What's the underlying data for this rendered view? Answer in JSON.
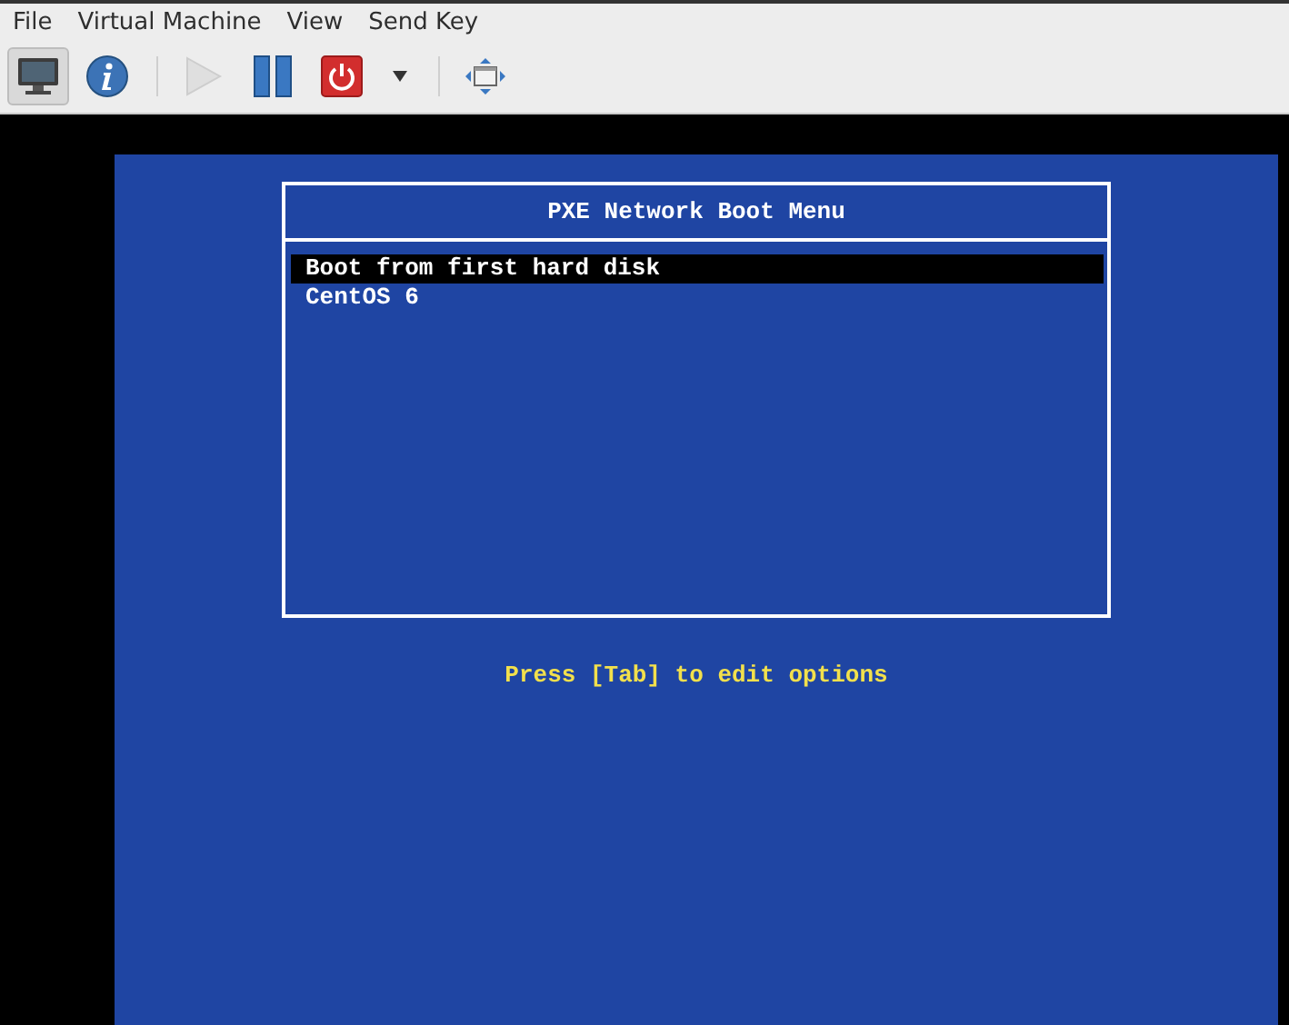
{
  "menu_bar": [
    {
      "label": "File"
    },
    {
      "label": "Virtual Machine"
    },
    {
      "label": "View"
    },
    {
      "label": "Send Key"
    }
  ],
  "toolbar": {
    "groups": [
      [
        {
          "kind": "console",
          "pressed": true,
          "disabled": false
        },
        {
          "kind": "info",
          "pressed": false,
          "disabled": false
        }
      ],
      [
        {
          "kind": "run",
          "pressed": false,
          "disabled": true
        },
        {
          "kind": "pause",
          "pressed": false,
          "disabled": false
        },
        {
          "kind": "shutdown",
          "pressed": false,
          "disabled": false
        },
        {
          "kind": "dropdown",
          "pressed": false,
          "disabled": false
        }
      ],
      [
        {
          "kind": "fullscreen",
          "pressed": false,
          "disabled": false
        }
      ]
    ]
  },
  "boot_menu": {
    "title": "PXE Network Boot Menu",
    "items": [
      {
        "label": "Boot from first hard disk",
        "selected": true
      },
      {
        "label": "CentOS 6",
        "selected": false
      }
    ],
    "hint": "Press [Tab] to edit options"
  }
}
